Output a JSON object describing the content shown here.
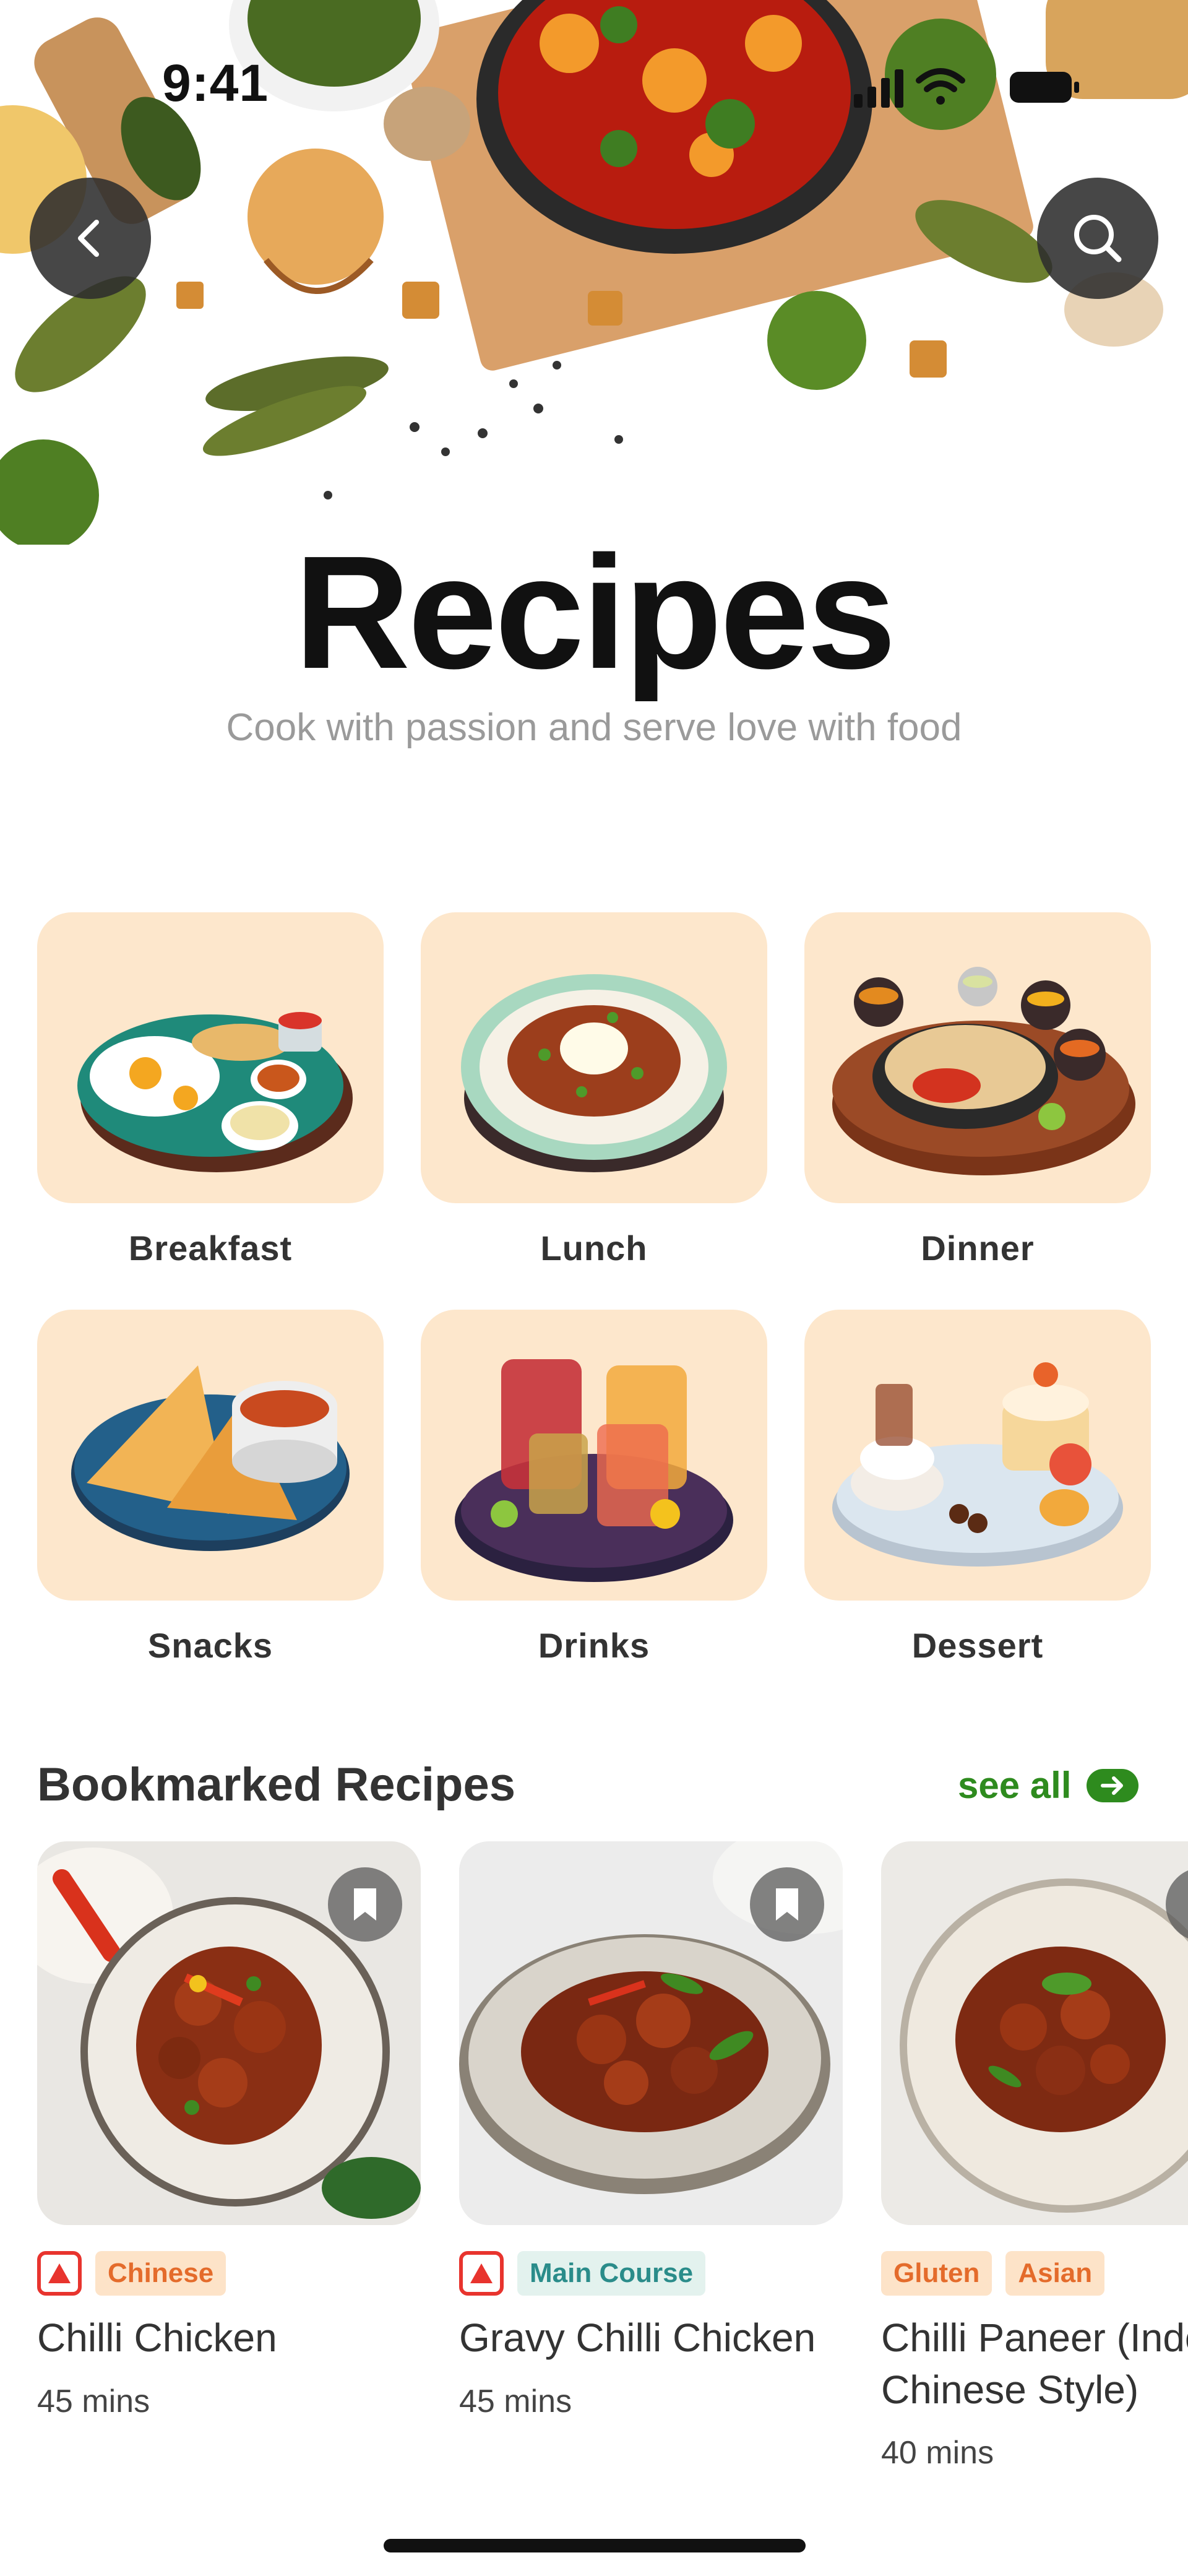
{
  "status_bar": {
    "time": "9:41"
  },
  "header": {
    "title": "Recipes",
    "subtitle": "Cook with passion and serve love with food",
    "back_icon": "chevron-left-icon",
    "search_icon": "search-icon"
  },
  "categories": [
    {
      "label": "Breakfast"
    },
    {
      "label": "Lunch"
    },
    {
      "label": "Dinner"
    },
    {
      "label": "Snacks"
    },
    {
      "label": "Drinks"
    },
    {
      "label": "Dessert"
    }
  ],
  "bookmarked": {
    "title": "Bookmarked Recipes",
    "see_all": "see all",
    "items": [
      {
        "veg_badge": true,
        "tags": [
          "Chinese"
        ],
        "title": "Chilli Chicken",
        "time": "45 mins"
      },
      {
        "veg_badge": true,
        "tags": [
          "Main Course"
        ],
        "title": "Gravy Chilli Chicken",
        "time": "45 mins"
      },
      {
        "veg_badge": false,
        "tags": [
          "Gluten",
          "Asian"
        ],
        "title": "Chilli Paneer (Indo Chinese Style)",
        "time": "40 mins"
      }
    ]
  },
  "colors": {
    "accent_green": "#2e8b1e",
    "tile_peach": "#fde7cc",
    "tag_orange_text": "#e46b2b",
    "tag_teal_text": "#2a8c8a",
    "nonveg_red": "#e8342e"
  }
}
